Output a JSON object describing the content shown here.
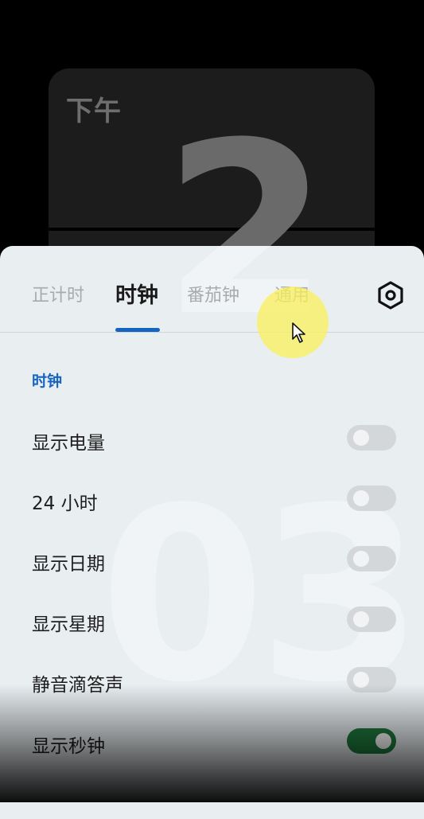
{
  "clock": {
    "ampm": "下午",
    "hour": "2",
    "minute": "03"
  },
  "tabs": [
    {
      "label": "正计时",
      "active": false
    },
    {
      "label": "时钟",
      "active": true
    },
    {
      "label": "番茄钟",
      "active": false
    },
    {
      "label": "通用",
      "active": false
    }
  ],
  "icons": {
    "settings": "hexagon-gear-icon",
    "cursor": "mouse-pointer-icon"
  },
  "section": {
    "title": "时钟"
  },
  "options": [
    {
      "label": "显示电量",
      "enabled": false
    },
    {
      "label": "24 小时",
      "enabled": false
    },
    {
      "label": "显示日期",
      "enabled": false
    },
    {
      "label": "显示星期",
      "enabled": false
    },
    {
      "label": "静音滴答声",
      "enabled": false
    },
    {
      "label": "显示秒钟",
      "enabled": true
    }
  ],
  "colors": {
    "accent": "#1565c0",
    "toggle_on": "#1e7a3c",
    "sheet_bg": "#e9eef1"
  }
}
